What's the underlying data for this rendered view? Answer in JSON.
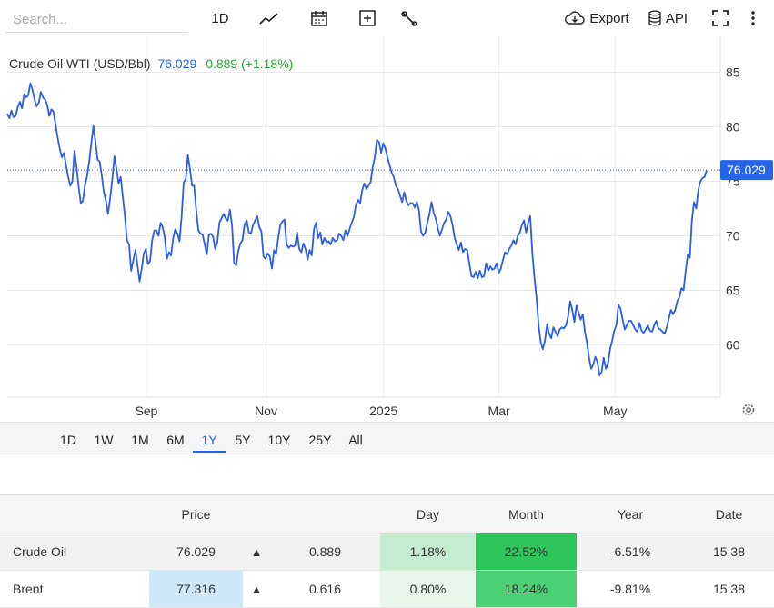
{
  "toolbar": {
    "search_placeholder": "Search...",
    "interval": "1D",
    "export_label": "Export",
    "api_label": "API"
  },
  "legend": {
    "name": "Crude Oil WTI (USD/Bbl)",
    "price": "76.029",
    "change": "0.889 (+1.18%)"
  },
  "ranges": [
    "1D",
    "1W",
    "1M",
    "6M",
    "1Y",
    "5Y",
    "10Y",
    "25Y",
    "All"
  ],
  "active_range": "1Y",
  "table": {
    "headers": [
      "",
      "Price",
      "",
      "",
      "Day",
      "Month",
      "Year",
      "Date"
    ],
    "rows": [
      {
        "name": "Crude Oil",
        "price": "76.029",
        "arrow": "▲",
        "change": "0.889",
        "day": "1.18%",
        "month": "22.52%",
        "year": "-6.51%",
        "date": "15:38"
      },
      {
        "name": "Brent",
        "price": "77.316",
        "arrow": "▲",
        "change": "0.616",
        "day": "0.80%",
        "month": "18.24%",
        "year": "-9.81%",
        "date": "15:38"
      }
    ]
  },
  "colors": {
    "line": "#2b5ee8",
    "price_tag": "#2563eb",
    "positive": "#22a830",
    "day_cell_1": "#c6ecd0",
    "day_cell_2": "#e8f7ec",
    "month_cell_1": "#2ec65a",
    "month_cell_2": "#4cd074",
    "brent_price_cell": "#cfe8f7"
  },
  "chart_data": {
    "type": "line",
    "title": "Crude Oil WTI (USD/Bbl)",
    "xlabel": "",
    "ylabel": "",
    "x_ticks": [
      "Sep",
      "Nov",
      "2025",
      "Mar",
      "May"
    ],
    "y_ticks": [
      60,
      65,
      70,
      75,
      80,
      85
    ],
    "ylim": [
      55.2,
      88.3
    ],
    "grid": true,
    "last_value": "76.029",
    "series": [
      {
        "values": [
          81.2,
          80.8,
          81.5,
          80.9,
          81.0,
          81.8,
          82.3,
          81.7,
          83.0,
          82.7,
          82.9,
          84.0,
          83.4,
          82.5,
          81.9,
          82.2,
          83.2,
          82.7,
          82.5,
          82.0,
          81.0,
          81.6,
          81.4,
          80.2,
          79.0,
          78.0,
          77.2,
          77.6,
          76.4,
          75.4,
          74.6,
          75.0,
          77.8,
          76.3,
          74.5,
          73.0,
          73.2,
          74.6,
          75.5,
          76.8,
          78.5,
          80.1,
          78.6,
          77.0,
          76.8,
          75.5,
          74.0,
          73.2,
          72.0,
          73.5,
          75.2,
          77.3,
          76.1,
          74.8,
          75.4,
          73.6,
          71.8,
          69.6,
          69.2,
          66.8,
          67.8,
          68.7,
          67.3,
          65.8,
          67.0,
          68.4,
          68.8,
          67.4,
          67.7,
          69.6,
          70.5,
          70.5,
          70.0,
          71.2,
          70.8,
          69.8,
          67.9,
          68.5,
          68.2,
          69.8,
          70.6,
          70.2,
          69.5,
          71.8,
          74.9,
          75.2,
          77.4,
          76.1,
          74.6,
          74.6,
          72.3,
          70.5,
          70.2,
          70.1,
          69.2,
          68.3,
          70.1,
          70.2,
          69.9,
          68.8,
          69.4,
          71.2,
          71.6,
          72.0,
          71.6,
          71.4,
          72.4,
          71.0,
          67.5,
          67.3,
          68.6,
          69.3,
          69.6,
          71.1,
          71.4,
          70.3,
          70.2,
          71.0,
          71.4,
          71.8,
          70.8,
          70.4,
          68.1,
          67.9,
          68.4,
          68.1,
          67.0,
          68.7,
          68.3,
          69.8,
          71.0,
          71.3,
          71.5,
          69.2,
          68.9,
          69.1,
          69.0,
          69.1,
          70.3,
          68.8,
          68.5,
          69.3,
          68.8,
          67.8,
          68.7,
          68.2,
          70.6,
          71.2,
          69.8,
          70.3,
          69.2,
          69.8,
          69.4,
          69.5,
          69.2,
          69.8,
          69.5,
          69.6,
          70.2,
          70.0,
          69.6,
          70.5,
          70.0,
          70.6,
          71.2,
          71.7,
          72.8,
          73.3,
          73.0,
          74.2,
          74.8,
          74.3,
          74.6,
          74.9,
          76.3,
          77.2,
          78.8,
          78.6,
          77.6,
          78.5,
          78.0,
          77.2,
          76.5,
          75.8,
          75.4,
          74.6,
          74.3,
          73.7,
          73.1,
          74.0,
          73.2,
          72.8,
          73.0,
          73.0,
          72.6,
          73.1,
          72.4,
          70.4,
          70.0,
          70.3,
          71.2,
          72.0,
          73.1,
          72.1,
          71.6,
          70.7,
          70.0,
          70.6,
          71.2,
          71.5,
          72.2,
          71.8,
          71.0,
          69.8,
          69.2,
          68.7,
          69.4,
          68.5,
          68.8,
          68.7,
          67.5,
          66.3,
          66.2,
          66.7,
          66.1,
          66.8,
          66.2,
          66.3,
          67.5,
          66.8,
          67.2,
          66.9,
          67.0,
          67.5,
          66.6,
          67.0,
          67.8,
          68.5,
          68.3,
          68.8,
          69.1,
          69.6,
          69.2,
          70.0,
          70.3,
          71.0,
          71.4,
          70.3,
          71.2,
          71.8,
          68.4,
          66.2,
          64.3,
          61.7,
          60.2,
          59.6,
          60.4,
          61.9,
          61.0,
          60.6,
          61.6,
          61.2,
          60.8,
          61.4,
          61.6,
          61.5,
          61.8,
          62.6,
          64.0,
          63.2,
          62.1,
          63.6,
          63.0,
          62.3,
          62.8,
          61.2,
          60.2,
          58.8,
          57.8,
          58.2,
          58.9,
          58.4,
          57.2,
          57.5,
          58.8,
          57.8,
          58.3,
          59.6,
          60.4,
          61.3,
          61.8,
          63.7,
          63.3,
          62.3,
          61.4,
          61.8,
          62.2,
          62.2,
          61.8,
          61.4,
          61.2,
          62.0,
          61.3,
          61.1,
          61.4,
          61.8,
          61.3,
          61.2,
          61.8,
          62.2,
          61.5,
          61.4,
          61.2,
          61.0,
          61.6,
          62.4,
          63.2,
          62.8,
          63.2,
          64.0,
          64.4,
          65.2,
          65.0,
          66.8,
          68.3,
          68.0,
          71.5,
          73.1,
          72.5,
          74.2,
          75.0,
          75.3,
          75.4,
          76.029
        ]
      }
    ]
  }
}
